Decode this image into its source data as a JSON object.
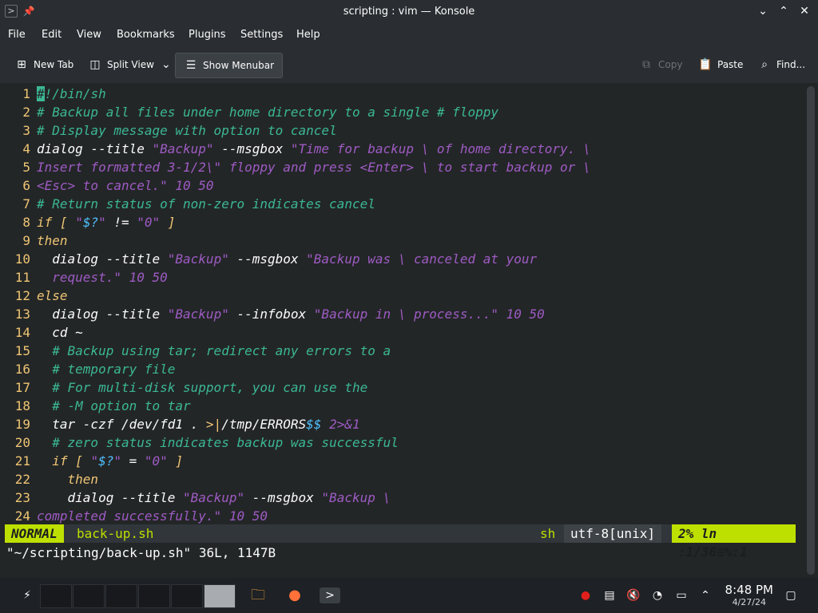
{
  "window": {
    "title": "scripting : vim — Konsole"
  },
  "menubar": {
    "items": [
      "File",
      "Edit",
      "View",
      "Bookmarks",
      "Plugins",
      "Settings",
      "Help"
    ]
  },
  "toolbar": {
    "new_tab": "New Tab",
    "split_view": "Split View",
    "show_menubar": "Show Menubar",
    "copy": "Copy",
    "paste": "Paste",
    "find": "Find..."
  },
  "editor": {
    "lines": [
      {
        "n": "1",
        "t": "#!/bin/sh"
      },
      {
        "n": "2",
        "t": "# Backup all files under home directory to a single # floppy"
      },
      {
        "n": "3",
        "t": "# Display message with option to cancel"
      },
      {
        "n": "4",
        "t": "dialog --title \"Backup\" --msgbox \"Time for backup \\ of home directory. \\"
      },
      {
        "n": "5",
        "t": "Insert formatted 3-1/2\\\" floppy and press <Enter> \\ to start backup or \\"
      },
      {
        "n": "6",
        "t": "<Esc> to cancel.\" 10 50"
      },
      {
        "n": "7",
        "t": "# Return status of non-zero indicates cancel"
      },
      {
        "n": "8",
        "t": "if [ \"$?\" != \"0\" ]"
      },
      {
        "n": "9",
        "t": "then"
      },
      {
        "n": "10",
        "t": "  dialog --title \"Backup\" --msgbox \"Backup was \\ canceled at your"
      },
      {
        "n": "11",
        "t": "  request.\" 10 50"
      },
      {
        "n": "12",
        "t": "else"
      },
      {
        "n": "13",
        "t": "  dialog --title \"Backup\" --infobox \"Backup in \\ process...\" 10 50"
      },
      {
        "n": "14",
        "t": "  cd ~"
      },
      {
        "n": "15",
        "t": "  # Backup using tar; redirect any errors to a"
      },
      {
        "n": "16",
        "t": "  # temporary file"
      },
      {
        "n": "17",
        "t": "  # For multi-disk support, you can use the"
      },
      {
        "n": "18",
        "t": "  # -M option to tar"
      },
      {
        "n": "19",
        "t": "  tar -czf /dev/fd1 . >|/tmp/ERRORS$$ 2>&1"
      },
      {
        "n": "20",
        "t": "  # zero status indicates backup was successful"
      },
      {
        "n": "21",
        "t": "  if [ \"$?\" = \"0\" ]"
      },
      {
        "n": "22",
        "t": "    then"
      },
      {
        "n": "23",
        "t": "    dialog --title \"Backup\" --msgbox \"Backup \\"
      },
      {
        "n": "24",
        "t": "completed successfully.\" 10 50"
      }
    ]
  },
  "statusline": {
    "mode": "NORMAL",
    "file": "back-up.sh",
    "filetype": "sh",
    "encoding": "utf-8[unix]",
    "position": "2% ln :1/36≡%:1"
  },
  "cmdline": "\"~/scripting/back-up.sh\" 36L, 1147B",
  "taskbar": {
    "time": "8:48 PM",
    "date": "4/27/24"
  }
}
